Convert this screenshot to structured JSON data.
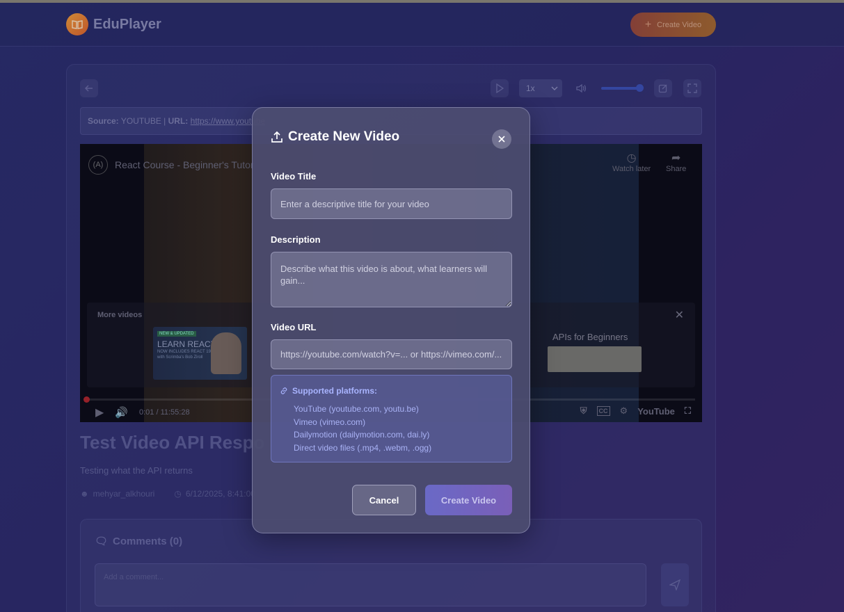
{
  "header": {
    "app_name": "EduPlayer",
    "create_button": "Create Video"
  },
  "player_toolbar": {
    "speed": "1x"
  },
  "source_bar": {
    "source_label": "Source:",
    "source_value": "YOUTUBE",
    "separator": "|",
    "url_label": "URL:",
    "url_value": "https://www.youtube"
  },
  "embed": {
    "title": "React Course - Beginner's Tutor",
    "watch_later": "Watch later",
    "share": "Share",
    "more_videos": "More videos",
    "thumb1_tag": "NEW & UPDATED",
    "thumb1_title": "LEARN REACT",
    "thumb1_sub1": "NOW INCLUDES REACT 19",
    "thumb1_sub2": "with Scrimba's Bob Ziroll",
    "thumb2_title": "APIs for Beginners",
    "time": "0:01 / 11:55:28",
    "youtube_brand": "YouTube"
  },
  "video_info": {
    "title": "Test Video API Respo",
    "description": "Testing what the API returns",
    "author": "mehyar_alkhouri",
    "date": "6/12/2025, 8:41:00"
  },
  "comments": {
    "title": "Comments (0)",
    "placeholder": "Add a comment..."
  },
  "modal": {
    "title": "Create New Video",
    "title_label": "Video Title",
    "title_placeholder": "Enter a descriptive title for your video",
    "description_label": "Description",
    "description_placeholder": "Describe what this video is about, what learners will gain...",
    "url_label": "Video URL",
    "url_placeholder": "https://youtube.com/watch?v=... or https://vimeo.com/...",
    "platforms_title": "Supported platforms:",
    "platforms": [
      "YouTube (youtube.com, youtu.be)",
      "Vimeo (vimeo.com)",
      "Dailymotion (dailymotion.com, dai.ly)",
      "Direct video files (.mp4, .webm, .ogg)"
    ],
    "cancel_button": "Cancel",
    "create_button": "Create Video"
  },
  "colors": {
    "accent_orange": "#e0632a",
    "accent_purple": "#6a69c6",
    "progress_red": "#b0262a",
    "volume_blue": "#3c52b6"
  },
  "progress": {
    "fraction": 0.0
  }
}
